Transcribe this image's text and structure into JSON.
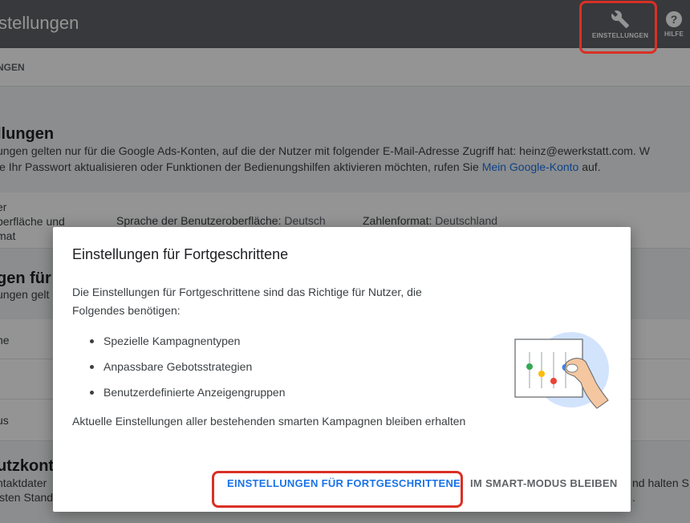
{
  "header": {
    "title": "stellungen",
    "settings_label": "EINSTELLUNGEN",
    "help_label": "HILFE",
    "help_glyph": "?"
  },
  "subnav": {
    "label": "NGEN"
  },
  "background": {
    "section1_title": "llungen",
    "section1_line1": "ungen gelten nur für die Google Ads-Konten, auf die der Nutzer mit folgender E-Mail-Adresse Zugriff hat: heinz@ewerkstatt.com. W",
    "section1_line2_prefix": "ie Ihr Passwort aktualisieren oder Funktionen der Bedienungshilfen aktivieren möchten, rufen Sie ",
    "section1_link": "Mein Google-Konto",
    "section1_line2_suffix": " auf.",
    "ui_label_line1": "er",
    "ui_label_line2": "berfläche und",
    "ui_label_line3": "mat",
    "language_label": "Sprache der Benutzeroberfläche: ",
    "language_value": "Deutsch",
    "number_format_label": "Zahlenformat: ",
    "number_format_value": "Deutschland",
    "section2_title": "gen für",
    "section2_text": "ungen gelt",
    "row1": "ne",
    "row2": "us",
    "section3_title": "utzkonta",
    "section3_line1": "ntaktdater",
    "section3_line2": "isten Stand",
    "right_line1": "nd halten S",
    "right_line2": "."
  },
  "dialog": {
    "title": "Einstellungen für Fortgeschrittene",
    "intro": "Die Einstellungen für Fortgeschrittene sind das Richtige für Nutzer, die Folgendes benötigen:",
    "list": [
      "Spezielle Kampagnentypen",
      "Anpassbare Gebotsstrategien",
      "Benutzerdefinierte Anzeigengruppen"
    ],
    "outro": "Aktuelle Einstellungen aller bestehenden smarten Kampagnen bleiben erhalten",
    "primary_button": "EINSTELLUNGEN FÜR FORTGESCHRITTENE",
    "secondary_button": "IM SMART-MODUS BLEIBEN"
  },
  "colors": {
    "header_bg": "#5f6368",
    "primary_blue": "#1a73e8",
    "highlight_red": "#d93025",
    "knob_green": "#34a853",
    "knob_yellow": "#fbbc04",
    "knob_red": "#ea4335",
    "knob_blue": "#4285f4",
    "illus_circle": "#d2e3fc"
  },
  "icons": {
    "settings": "wrench-icon",
    "help": "help-icon"
  }
}
